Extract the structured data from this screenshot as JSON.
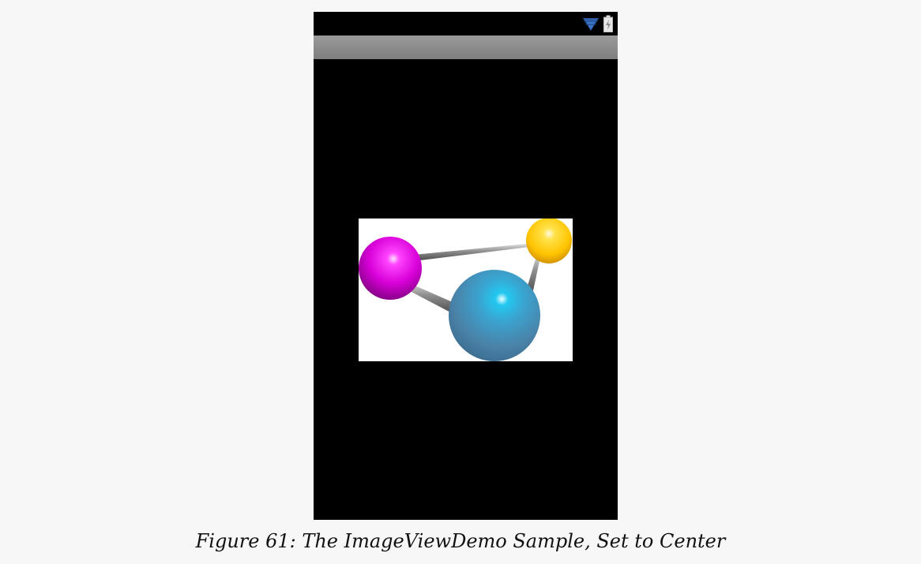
{
  "device": {
    "status_bar": {
      "icons": [
        "wifi-icon",
        "battery-icon"
      ]
    },
    "title_bar": {
      "title": ""
    },
    "image_view": {
      "scale_type": "center",
      "image": {
        "description_icon": "molecule-image",
        "colors": {
          "magenta_sphere": "#d800d8",
          "yellow_sphere": "#ffcc00",
          "blue_sphere": "#4a82a8",
          "highlight_cyan": "#22c8f0"
        }
      }
    }
  },
  "caption": {
    "text": "Figure 61: The ImageViewDemo Sample, Set to Center"
  }
}
